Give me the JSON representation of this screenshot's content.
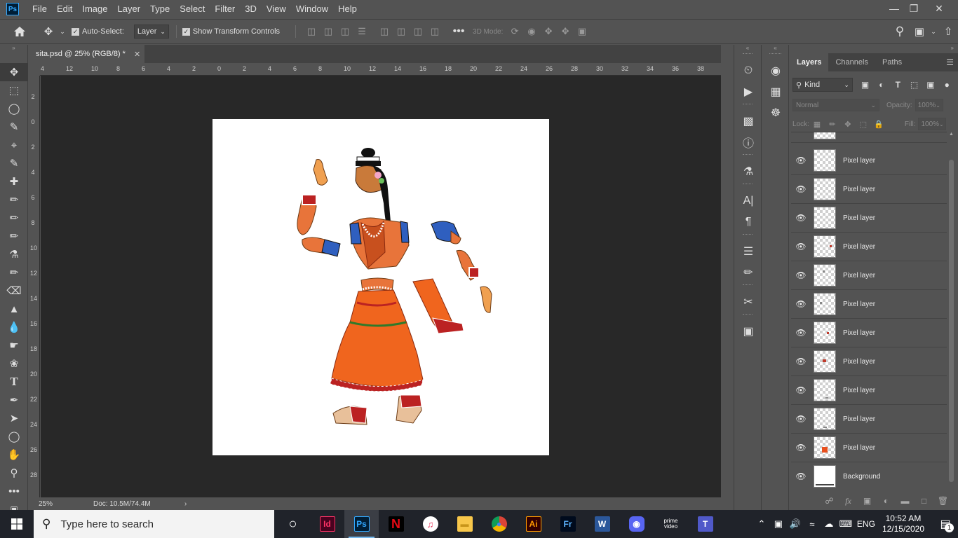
{
  "menubar": {
    "logo": "Ps",
    "items": [
      "File",
      "Edit",
      "Image",
      "Layer",
      "Type",
      "Select",
      "Filter",
      "3D",
      "View",
      "Window",
      "Help"
    ]
  },
  "options": {
    "auto_select_label": "Auto-Select:",
    "auto_select_value": "Layer",
    "show_transform_label": "Show Transform Controls",
    "mode_3d_label": "3D Mode:"
  },
  "document": {
    "tab_title": "sita.psd @ 25% (RGB/8) *",
    "zoom": "25%",
    "doc_size": "Doc: 10.5M/74.4M"
  },
  "ruler": {
    "h_labels": [
      "4",
      "12",
      "10",
      "8",
      "6",
      "4",
      "2",
      "0",
      "2",
      "4",
      "6",
      "8",
      "10",
      "12",
      "14",
      "16",
      "18",
      "20",
      "22",
      "24",
      "26",
      "28",
      "30",
      "32",
      "34",
      "36",
      "38",
      "4"
    ],
    "v_labels": [
      "2",
      "0",
      "2",
      "4",
      "6",
      "8",
      "10",
      "12",
      "14",
      "16",
      "18",
      "20",
      "22",
      "24",
      "26",
      "28"
    ]
  },
  "layers_panel": {
    "tabs": [
      "Layers",
      "Channels",
      "Paths"
    ],
    "kind_label": "Kind",
    "blend_mode": "Normal",
    "opacity_label": "Opacity:",
    "opacity_value": "100%",
    "lock_label": "Lock:",
    "fill_label": "Fill:",
    "fill_value": "100%",
    "layers": [
      {
        "name": "Pixel layer"
      },
      {
        "name": "Pixel layer"
      },
      {
        "name": "Pixel layer"
      },
      {
        "name": "Pixel layer"
      },
      {
        "name": "Pixel layer"
      },
      {
        "name": "Pixel layer"
      },
      {
        "name": "Pixel layer"
      },
      {
        "name": "Pixel layer"
      },
      {
        "name": "Pixel layer"
      },
      {
        "name": "Pixel layer"
      },
      {
        "name": "Pixel layer"
      },
      {
        "name": "Background"
      }
    ]
  },
  "taskbar": {
    "search_placeholder": "Type here to search",
    "apps": [
      {
        "name": "task-view",
        "label": "○"
      },
      {
        "name": "indesign",
        "label": "Id",
        "color": "#49021f",
        "fg": "#ff3366"
      },
      {
        "name": "photoshop",
        "label": "Ps",
        "color": "#001e36",
        "fg": "#31a8ff"
      },
      {
        "name": "netflix",
        "label": "N",
        "color": "#000000",
        "fg": "#e50914"
      },
      {
        "name": "itunes",
        "label": "♫",
        "color": "#ffffff",
        "fg": "#e8365d"
      },
      {
        "name": "file-explorer",
        "label": "▬",
        "color": "#f8c74a",
        "fg": "#c8951a"
      },
      {
        "name": "chrome",
        "label": "●",
        "color": "#db4437",
        "fg": "#4285f4"
      },
      {
        "name": "illustrator",
        "label": "Ai",
        "color": "#330000",
        "fg": "#ff9a00"
      },
      {
        "name": "fresco",
        "label": "Fr",
        "color": "#000b1d",
        "fg": "#5cb4ff"
      },
      {
        "name": "word",
        "label": "W",
        "color": "#2b579a",
        "fg": "#ffffff"
      },
      {
        "name": "discord",
        "label": "◉",
        "color": "#5865f2",
        "fg": "#ffffff"
      },
      {
        "name": "prime-video",
        "label": "prime video",
        "color": "#20232a",
        "fg": "#ffffff"
      },
      {
        "name": "teams",
        "label": "T",
        "color": "#5059c9",
        "fg": "#ffffff"
      }
    ],
    "language": "ENG",
    "time": "10:52 AM",
    "date": "12/15/2020",
    "notification_count": "1"
  }
}
